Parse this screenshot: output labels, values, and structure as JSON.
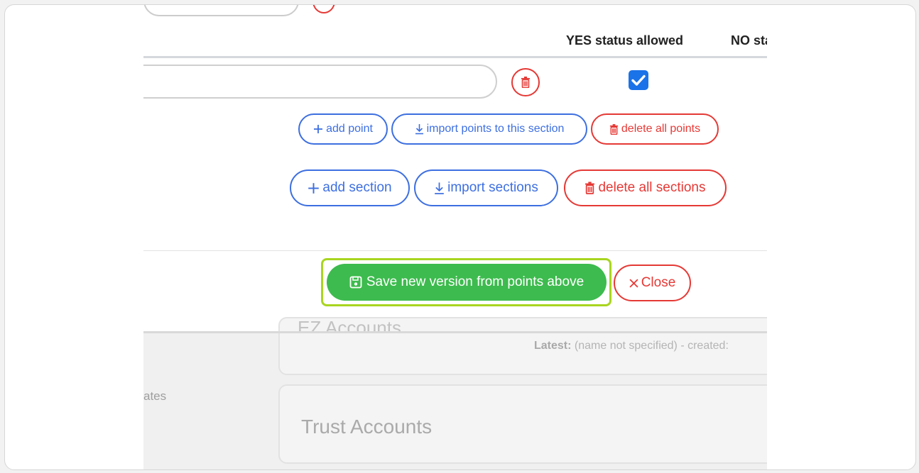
{
  "table": {
    "yes_header": "YES status allowed",
    "no_header": "NO stat"
  },
  "point": {
    "input_value": "",
    "checked": true
  },
  "point_actions": {
    "add_point": "add point",
    "import_points": "import points to this section",
    "delete_points": "delete all points"
  },
  "section_actions": {
    "add_section": "add section",
    "import_sections": "import sections",
    "delete_sections": "delete all sections"
  },
  "footer": {
    "save_label": "Save new version from points above",
    "close_label": "Close"
  },
  "background": {
    "card1_title": "EZ Accounts",
    "latest_label": "Latest:",
    "latest_text": "(name not specified) - created:",
    "card2_title": "Trust Accounts",
    "side_text": "ates"
  },
  "colors": {
    "blue": "#3d6fe0",
    "red": "#e53935",
    "green": "#3dbb4e",
    "highlight": "#a8d51f",
    "checkbox": "#1a73e8"
  }
}
